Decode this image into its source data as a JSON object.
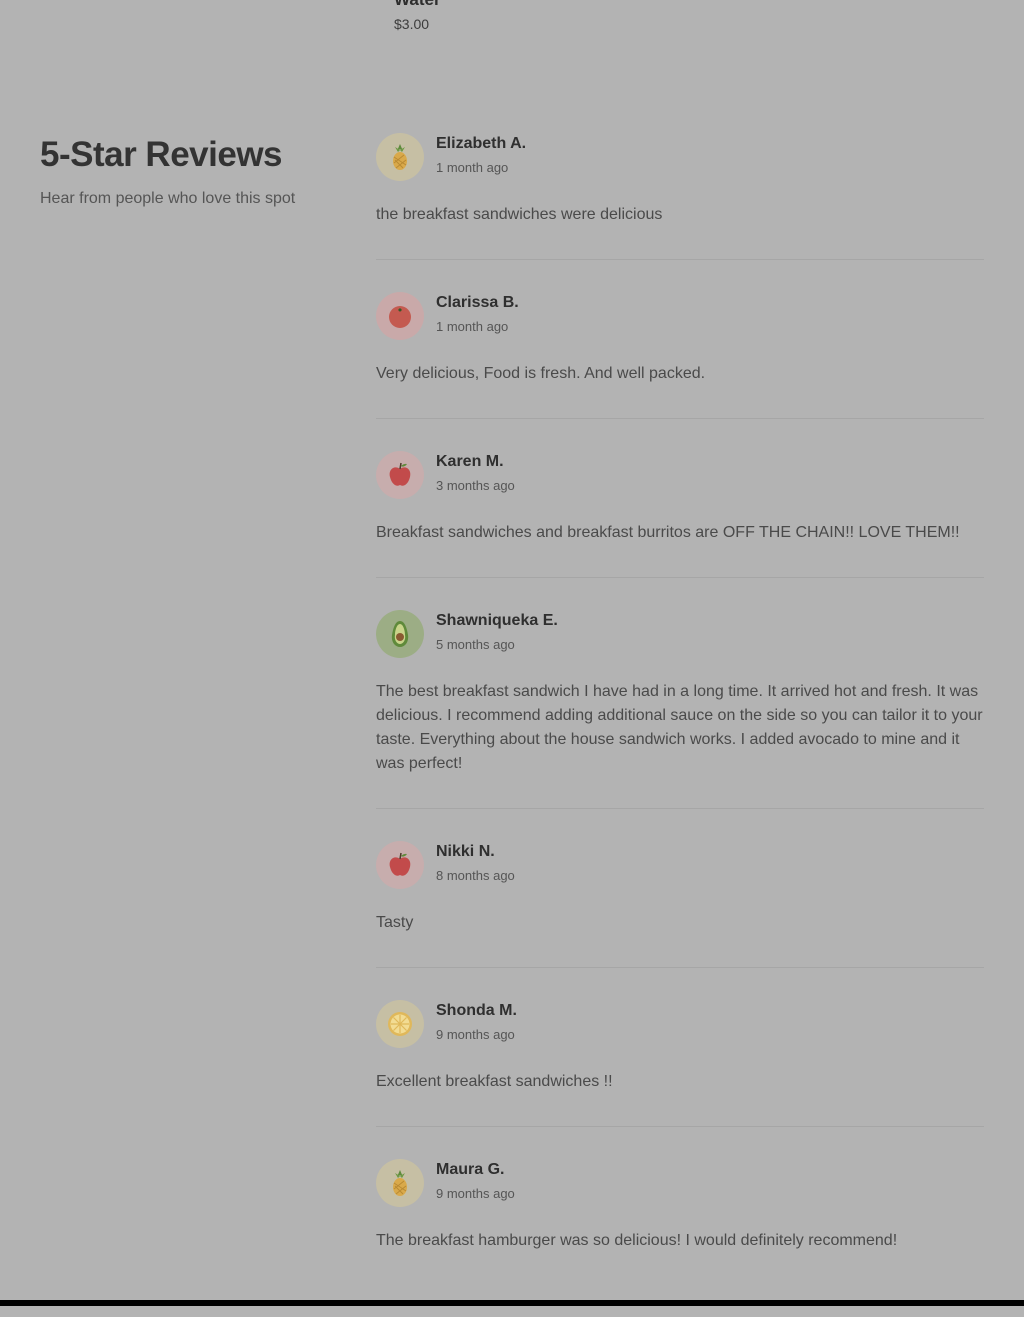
{
  "menu_item": {
    "name": "Water",
    "price": "$3.00"
  },
  "reviews_section": {
    "title": "5-Star Reviews",
    "subtitle": "Hear from people who love this spot"
  },
  "reviews": [
    {
      "name": "Elizabeth A.",
      "date": "1 month ago",
      "text": "the breakfast sandwiches were delicious",
      "avatar": "pineapple-icon",
      "avatar_bg": "#c6bfa4"
    },
    {
      "name": "Clarissa B.",
      "date": "1 month ago",
      "text": "Very delicious, Food is fresh. And well packed.",
      "avatar": "tomato-icon",
      "avatar_bg": "#c9a9a9"
    },
    {
      "name": "Karen M.",
      "date": "3 months ago",
      "text": "Breakfast sandwiches and breakfast burritos are OFF THE CHAIN!! LOVE THEM!!",
      "avatar": "apple-icon",
      "avatar_bg": "#c7adad"
    },
    {
      "name": "Shawniqueka E.",
      "date": "5 months ago",
      "text": "The best breakfast sandwich I have had in a long time. It arrived hot and fresh. It was delicious. I recommend adding additional sauce on the side so you can tailor it to your taste. Everything about the house sandwich works. I added avocado to mine and it was perfect!",
      "avatar": "avocado-icon",
      "avatar_bg": "#9cad85"
    },
    {
      "name": "Nikki N.",
      "date": "8 months ago",
      "text": "Tasty",
      "avatar": "apple-icon",
      "avatar_bg": "#c7adad"
    },
    {
      "name": "Shonda M.",
      "date": "9 months ago",
      "text": "Excellent breakfast sandwiches !!",
      "avatar": "lemon-slice-icon",
      "avatar_bg": "#c6bfa4"
    },
    {
      "name": "Maura G.",
      "date": "9 months ago",
      "text": "The breakfast hamburger was so delicious! I would definitely recommend!",
      "avatar": "pineapple-icon",
      "avatar_bg": "#c6bfa4"
    }
  ]
}
